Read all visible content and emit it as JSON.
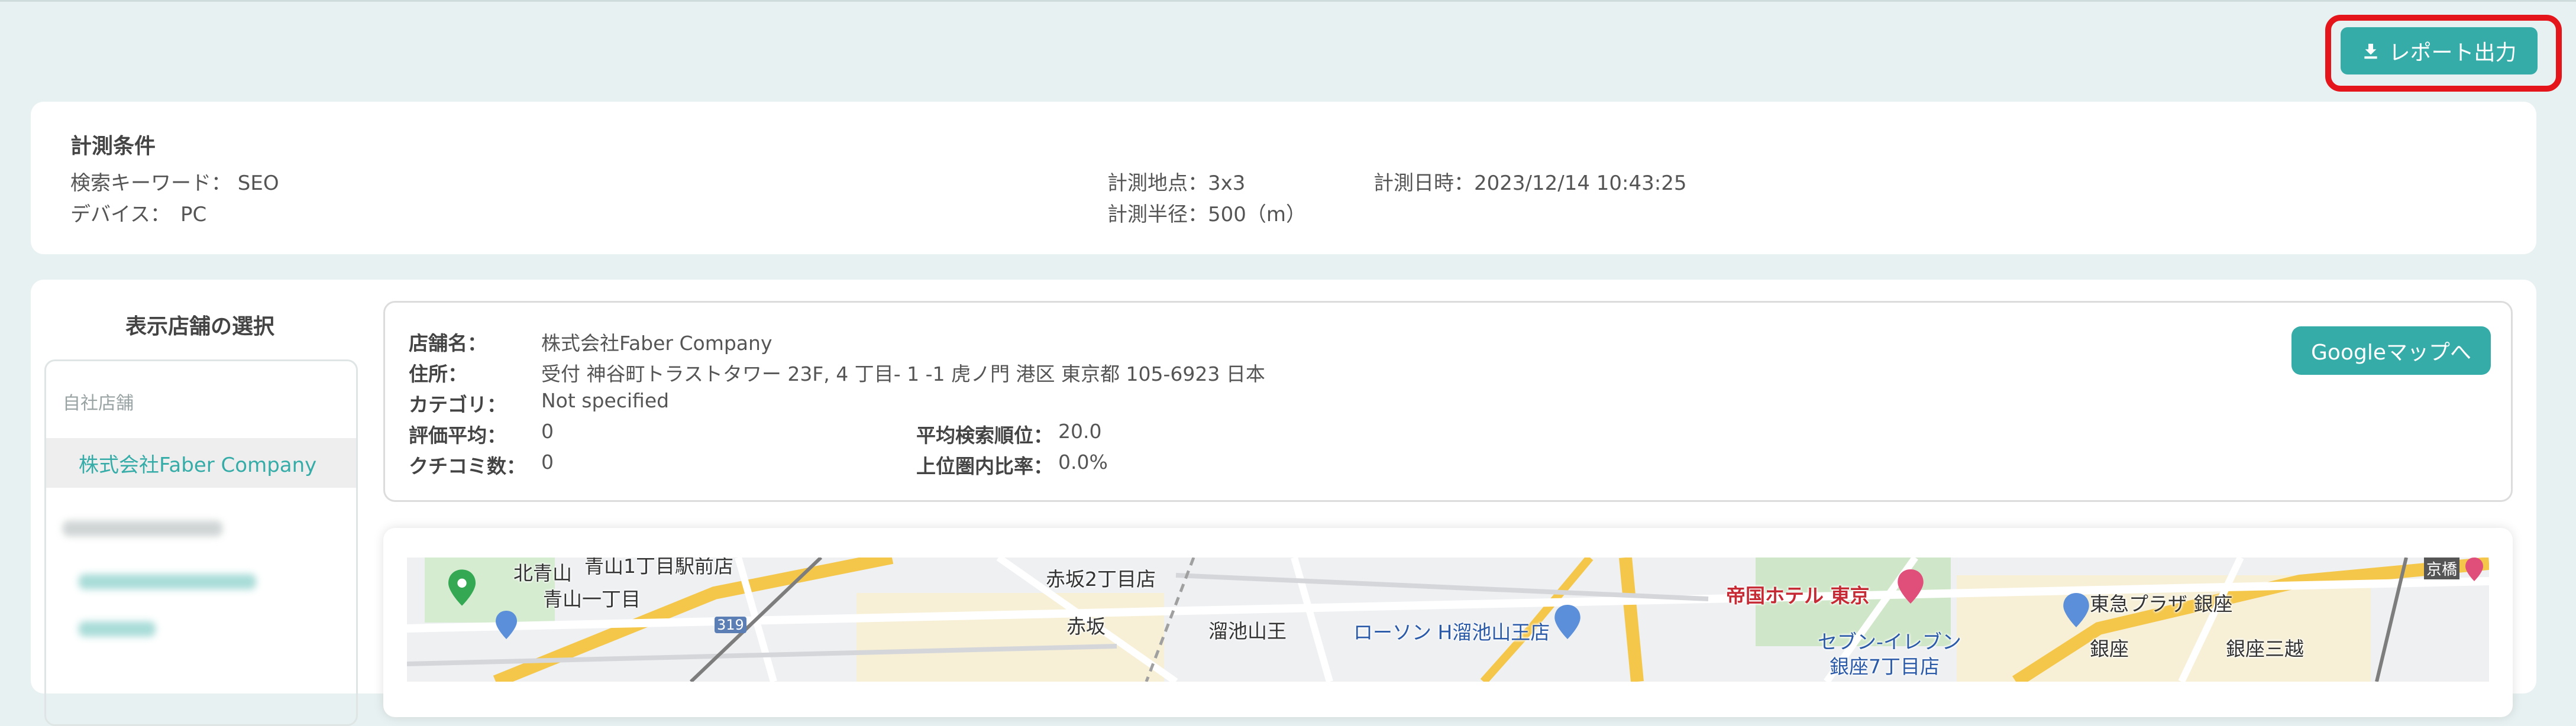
{
  "toolbar": {
    "report_button": "レポート出力"
  },
  "conditions": {
    "title": "計測条件",
    "keyword": "検索キーワード： SEO",
    "device": "デバイス：　PC",
    "points": "計測地点：3x3",
    "radius": "計測半径：500（m）",
    "datetime": "計測日時：2023/12/14 10:43:25"
  },
  "sidebar": {
    "title": "表示店舗の選択",
    "own_label": "自社店舗",
    "own_store": "株式会社Faber Company"
  },
  "store": {
    "name_label": "店舗名：",
    "name": "株式会社Faber Company",
    "address_label": "住所：",
    "address": "受付 神谷町トラストタワー 23F, 4 丁目- 1 -1 虎ノ門 港区 東京都 105-6923 日本",
    "category_label": "カテゴリ：",
    "category": "Not specified",
    "rating_label": "評価平均：",
    "rating": "0",
    "reviews_label": "クチコミ数：",
    "reviews": "0",
    "avg_rank_label": "平均検索順位：",
    "avg_rank": "20.0",
    "top_ratio_label": "上位圏内比率：",
    "top_ratio": "0.0%",
    "gmaps_button": "Googleマップへ"
  },
  "map": {
    "labels": {
      "kitaaoyama": "北青山",
      "aoyama1st": "青山1丁目駅前店",
      "aoyama1": "青山一丁目",
      "route": "319",
      "akasaka2": "赤坂2丁目店",
      "akasaka": "赤坂",
      "tameike": "溜池山王",
      "lawson": "ローソン H溜池山王店",
      "teikoku": "帝国ホテル 東京",
      "seven": "セブン-イレブン",
      "ginza7": "銀座7丁目店",
      "tokyu": "東急プラザ 銀座",
      "ginza": "銀座",
      "ginza_mitsukoshi": "銀座三越",
      "kyobashi": "京橋"
    }
  },
  "colors": {
    "accent": "#35aca7",
    "highlight": "#e4161c"
  }
}
